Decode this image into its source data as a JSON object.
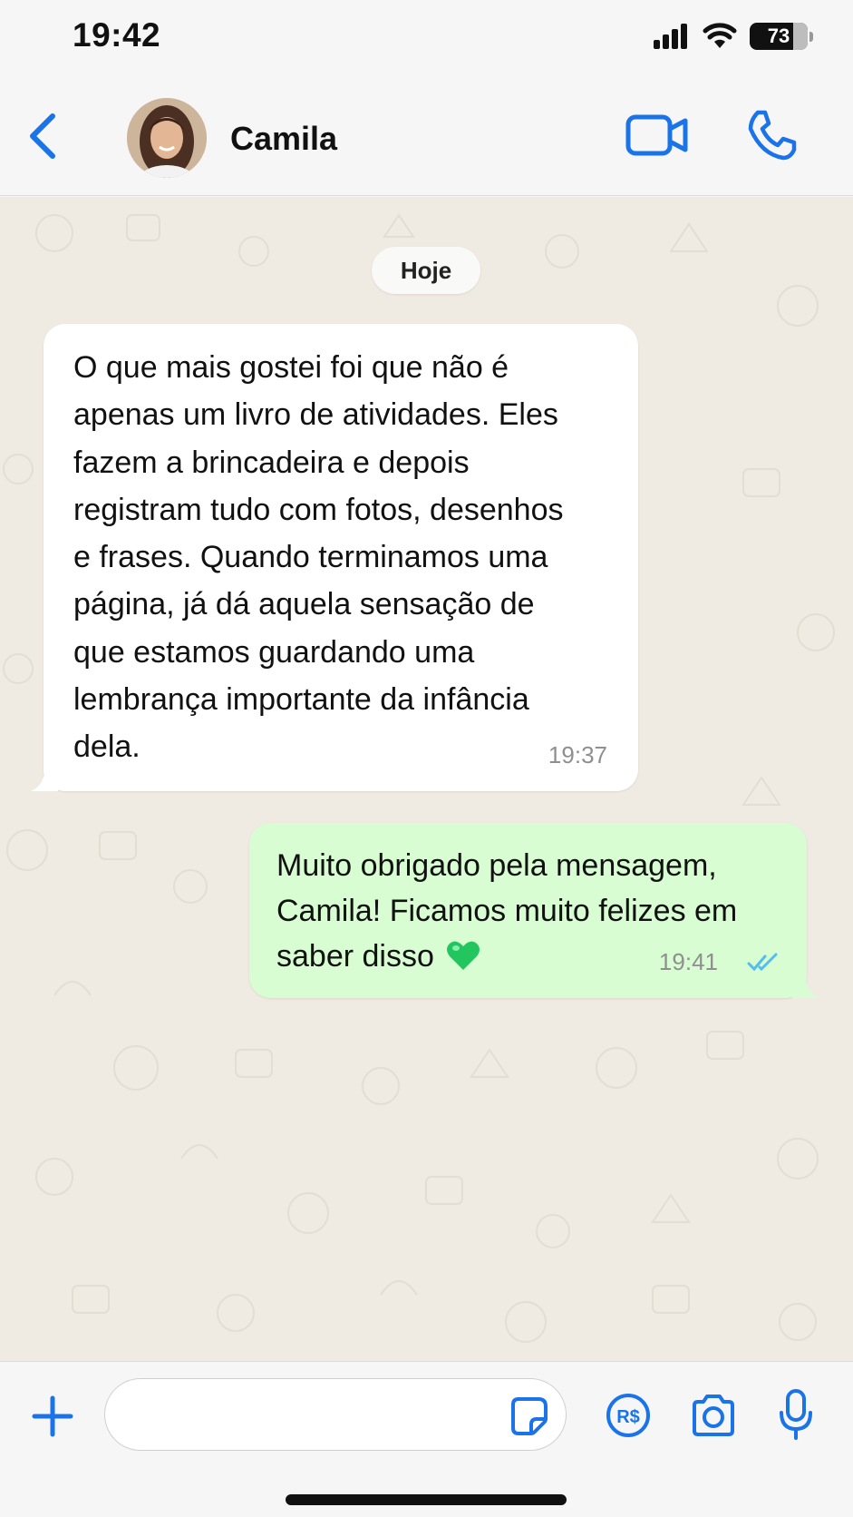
{
  "status_bar": {
    "time": "19:42",
    "battery": "73",
    "icons": [
      "signal-icon",
      "wifi-icon",
      "battery-icon"
    ]
  },
  "header": {
    "contact_name": "Camila",
    "icons": [
      "back-chevron-icon",
      "avatar",
      "video-call-icon",
      "phone-icon"
    ]
  },
  "chat": {
    "date_label": "Hoje",
    "messages": [
      {
        "direction": "incoming",
        "text": "O que mais gostei foi que não é\napenas um livro de atividades. Eles\nfazem a brincadeira e depois\nregistram tudo com fotos, desenhos\ne frases. Quando terminamos uma\npágina, já dá aquela sensação de\nque estamos guardando uma\nlembrança importante da infância\ndela.",
        "time": "19:37"
      },
      {
        "direction": "outgoing",
        "text_line1": "Muito obrigado pela mensagem,",
        "text_line2": "Camila! Ficamos muito felizes em",
        "text_line3": "saber disso",
        "emoji": "green-heart",
        "time": "19:41",
        "status": "read-double-check"
      }
    ]
  },
  "input_bar": {
    "placeholder": "",
    "icons": [
      "plus-icon",
      "sticker-icon",
      "pix-payment-icon",
      "camera-icon",
      "microphone-icon"
    ],
    "payment_label": "R$"
  },
  "colors": {
    "accent": "#1a73e8",
    "outgoing_bubble": "#d9fdd3",
    "chat_background": "#efeae2",
    "read_ticks": "#53bdeb",
    "heart": "#22c55e"
  }
}
